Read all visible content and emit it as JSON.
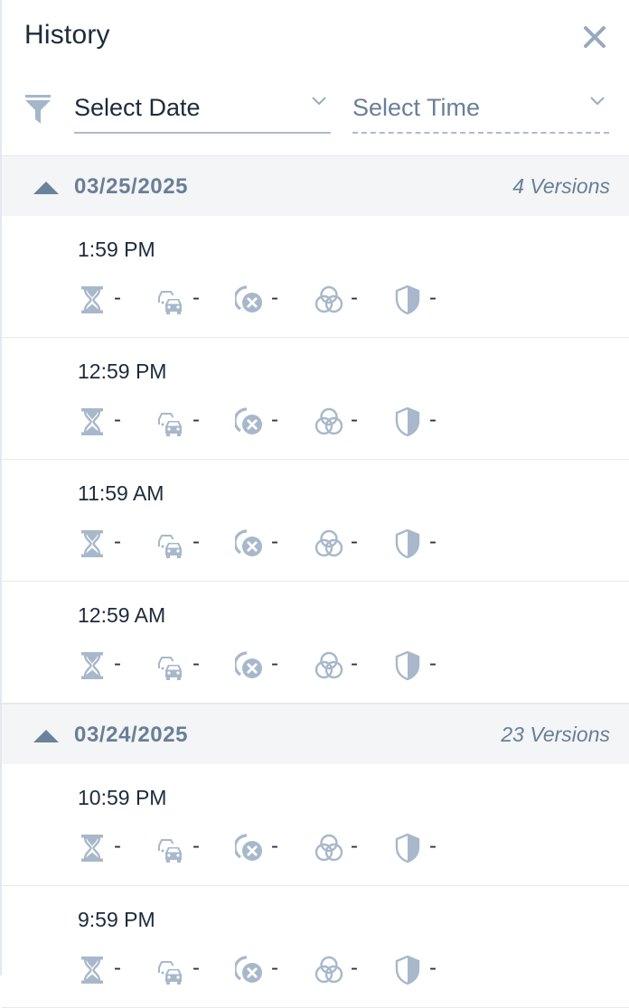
{
  "header": {
    "title": "History"
  },
  "filters": {
    "date_placeholder": "Select Date",
    "time_placeholder": "Select Time"
  },
  "colors": {
    "icon": "#a8b8ca",
    "accent_text": "#6a7e96",
    "group_bg": "#f3f5f7"
  },
  "metric_icons": [
    "hourglass-icon",
    "cars-icon",
    "cancel-circle-icon",
    "venn-circles-icon",
    "shield-icon"
  ],
  "groups": [
    {
      "date": "03/25/2025",
      "count": "4 Versions",
      "rows": [
        {
          "time": "1:59 PM",
          "metrics": [
            "-",
            "-",
            "-",
            "-",
            "-"
          ]
        },
        {
          "time": "12:59 PM",
          "metrics": [
            "-",
            "-",
            "-",
            "-",
            "-"
          ]
        },
        {
          "time": "11:59 AM",
          "metrics": [
            "-",
            "-",
            "-",
            "-",
            "-"
          ]
        },
        {
          "time": "12:59 AM",
          "metrics": [
            "-",
            "-",
            "-",
            "-",
            "-"
          ]
        }
      ]
    },
    {
      "date": "03/24/2025",
      "count": "23 Versions",
      "rows": [
        {
          "time": "10:59 PM",
          "metrics": [
            "-",
            "-",
            "-",
            "-",
            "-"
          ]
        },
        {
          "time": "9:59 PM",
          "metrics": [
            "-",
            "-",
            "-",
            "-",
            "-"
          ]
        }
      ]
    }
  ]
}
